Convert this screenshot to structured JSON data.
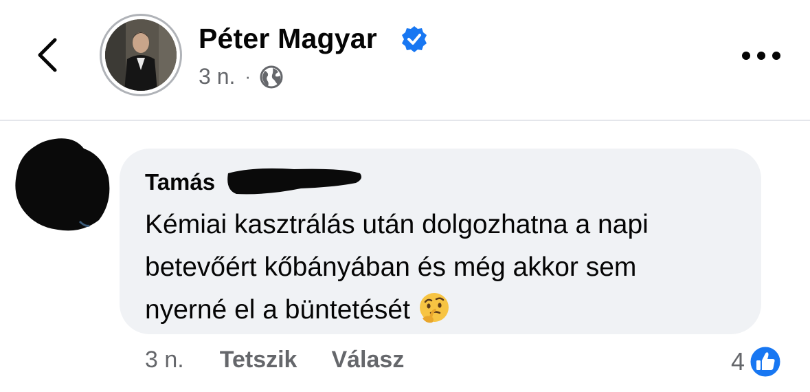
{
  "header": {
    "page_name": "Péter Magyar",
    "timestamp": "3 n.",
    "separator": "·",
    "icons": {
      "back": "chevron-left-icon",
      "verified": "verified-badge-icon",
      "privacy": "globe-icon",
      "more": "more-horizontal-icon"
    }
  },
  "comment": {
    "author_visible": "Tamás",
    "lines": [
      "Kémiai kasztrálás után dolgozhatna a napi",
      "betevőért kőbányában és még akkor sem",
      "nyerné el a büntetését"
    ],
    "emoji": "thinking-face-emoji",
    "timestamp": "3 n.",
    "actions": {
      "like": "Tetszik",
      "reply": "Válasz"
    },
    "reaction_count": "4",
    "reaction_type": "like-icon"
  },
  "colors": {
    "verified_blue": "#1877f2",
    "bubble_bg": "#f0f2f5",
    "secondary_text": "#65676b",
    "divider": "#e4e6eb"
  }
}
